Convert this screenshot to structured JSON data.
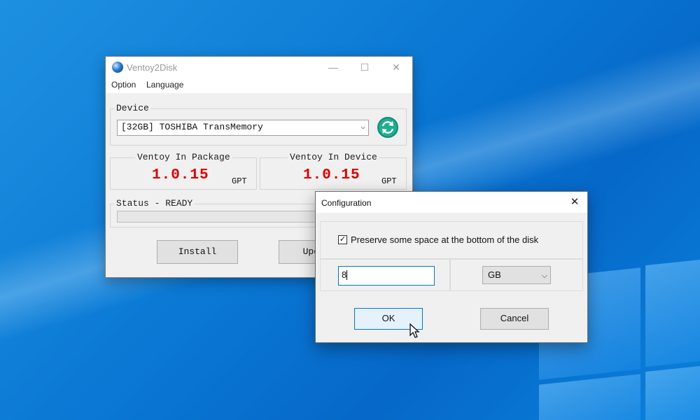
{
  "main_window": {
    "title": "Ventoy2Disk",
    "controls": {
      "minimize": "—",
      "maximize": "☐",
      "close": "✕"
    },
    "menu": [
      "Option",
      "Language"
    ],
    "device": {
      "label": "Device",
      "selected": "[32GB] TOSHIBA TransMemory",
      "arrow": "⌵"
    },
    "package": {
      "label": "Ventoy In Package",
      "version": "1.0.15",
      "style": "GPT"
    },
    "installed": {
      "label": "Ventoy In Device",
      "version": "1.0.15",
      "style": "GPT"
    },
    "status": {
      "label": "Status - READY",
      "progress": 0
    },
    "buttons": {
      "install": "Install",
      "update": "Update"
    }
  },
  "dialog": {
    "title": "Configuration",
    "close": "✕",
    "checkbox": {
      "checked": true,
      "mark": "✓",
      "label": "Preserve some space at the bottom of the disk"
    },
    "size_value": "8",
    "unit": {
      "selected": "GB",
      "arrow": "⌵"
    },
    "buttons": {
      "ok": "OK",
      "cancel": "Cancel"
    }
  },
  "colors": {
    "version_red": "#e00000",
    "refresh_green": "#1fae8f",
    "focus_blue": "#0078d7",
    "desktop_blue": "#0a78d4"
  },
  "icons": {
    "app": "ventoy-logo-icon",
    "refresh": "refresh-icon",
    "cursor": "mouse-pointer-icon"
  }
}
